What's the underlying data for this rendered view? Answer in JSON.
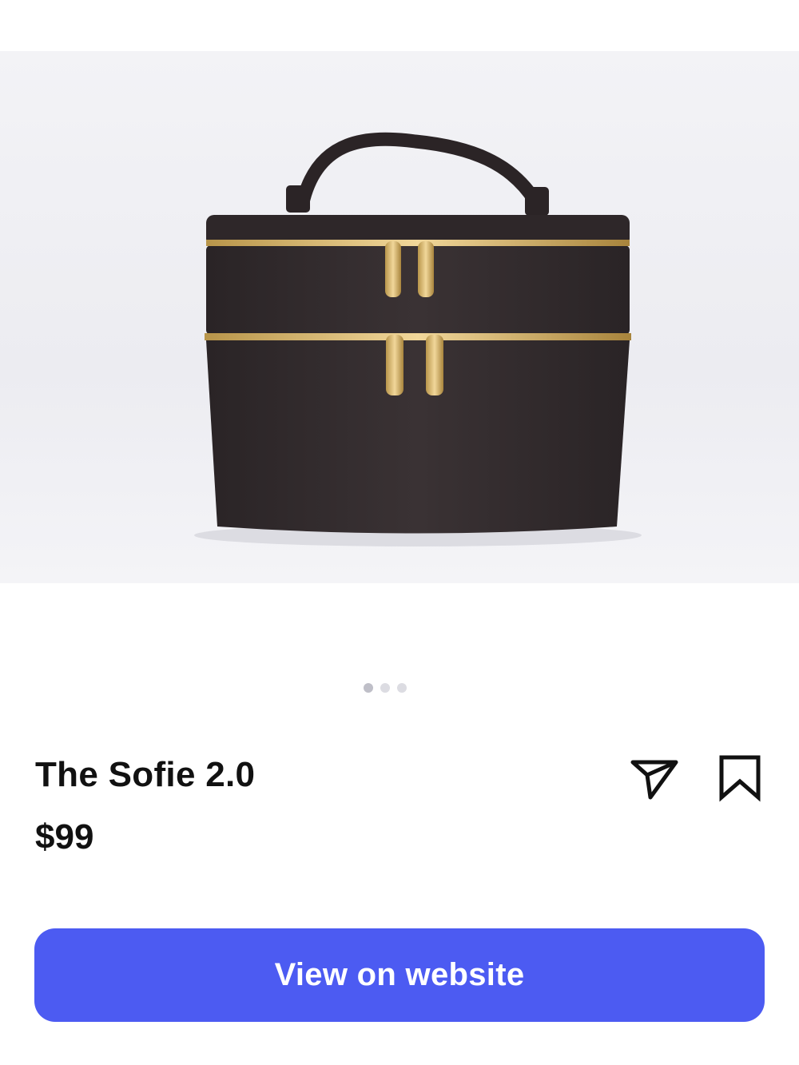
{
  "product": {
    "title": "The Sofie 2.0",
    "price": "$99",
    "image_alt": "black vanity case"
  },
  "carousel": {
    "count": 3,
    "active_index": 0
  },
  "actions": {
    "share_icon": "send-icon",
    "save_icon": "bookmark-icon"
  },
  "cta": {
    "label": "View on website",
    "color": "#4c5bf2"
  }
}
